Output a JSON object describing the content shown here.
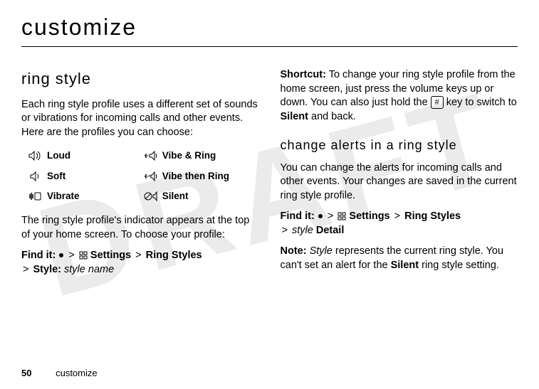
{
  "watermark": "DRAFT",
  "page_title": "customize",
  "left": {
    "heading": "ring style",
    "intro": "Each ring style profile uses a different set of sounds or vibrations for incoming calls and other events. Here are the profiles you can choose:",
    "profiles": [
      {
        "icon": "loud-icon",
        "label": "Loud"
      },
      {
        "icon": "vibe-ring-icon",
        "label": "Vibe & Ring"
      },
      {
        "icon": "soft-icon",
        "label": "Soft"
      },
      {
        "icon": "vibe-then-ring-icon",
        "label": "Vibe then Ring"
      },
      {
        "icon": "vibrate-icon",
        "label": "Vibrate"
      },
      {
        "icon": "silent-icon",
        "label": "Silent"
      }
    ],
    "after_profiles": "The ring style profile's indicator appears at the top of your home screen. To choose your profile:",
    "find_it_label": "Find it:",
    "settings_label": "Settings",
    "ring_styles_label": "Ring Styles",
    "style_prefix": "Style:",
    "style_name": "style name"
  },
  "right": {
    "shortcut_label": "Shortcut:",
    "shortcut_text_1": "To change your ring style profile from the home screen, just press the volume keys up or down. You can also just hold the",
    "shortcut_key": "#",
    "shortcut_text_2": "key to switch to",
    "shortcut_silent": "Silent",
    "shortcut_text_3": "and back.",
    "subheading": "change alerts in a ring style",
    "sub_intro": "You can change the alerts for incoming calls and other events. Your changes are saved in the current ring style profile.",
    "find_it_label": "Find it:",
    "settings_label": "Settings",
    "ring_styles_label": "Ring Styles",
    "style_word": "style",
    "detail_label": "Detail",
    "note_label": "Note:",
    "note_text_1": "Style",
    "note_text_2": "represents the current ring style. You can't set an alert for the",
    "note_silent": "Silent",
    "note_text_3": "ring style setting."
  },
  "footer": {
    "page_number": "50",
    "section": "customize"
  }
}
